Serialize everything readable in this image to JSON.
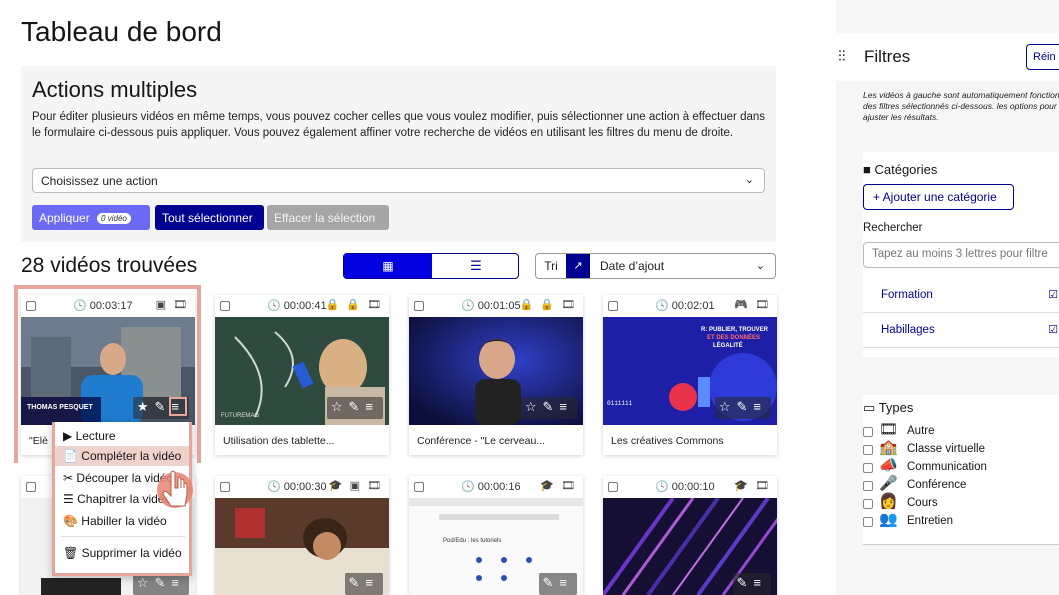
{
  "page_title": "Tableau de bord",
  "bulk": {
    "title": "Actions multiples",
    "description": "Pour éditer plusieurs vidéos en même temps, vous pouvez cocher celles que vous voulez modifier, puis sélectionner une action à effectuer dans le formulaire ci-dessous puis appliquer. Vous pouvez également affiner votre recherche de vidéos en utilisant les filtres du menu de droite.",
    "select_placeholder": "Choisissez une action",
    "apply_label": "Appliquer",
    "apply_badge": "0 vidéo",
    "select_all_label": "Tout sélectionner",
    "clear_label": "Effacer la sélection"
  },
  "results": {
    "count_label": "28 vidéos trouvées",
    "sort_label": "Tri",
    "sort_direction_icon": "↗",
    "sort_value": "Date d’ajout"
  },
  "videos": [
    {
      "duration": "00:03:17",
      "title": "\"Elè",
      "icons": "▣ 🎞"
    },
    {
      "duration": "00:00:41",
      "title": "Utilisation des tablette...",
      "icons": "🔒 🔒 🎞"
    },
    {
      "duration": "00:01:05",
      "title": "Conférence - \"Le cerveau...",
      "icons": "🔒 🔒 🎞"
    },
    {
      "duration": "00:02:01",
      "title": "Les créatives Commons",
      "icons": "🎮 🎞"
    },
    {
      "duration": "",
      "title": "",
      "icons": ""
    },
    {
      "duration": "00:00:30",
      "title": "",
      "icons": "🎓 ▣ 🎞"
    },
    {
      "duration": "00:00:16",
      "title": "",
      "icons": "🎓 🎞"
    },
    {
      "duration": "00:00:10",
      "title": "",
      "icons": "🎓 🎞"
    }
  ],
  "thumb_texts": {
    "v1_name": "THOMAS PESQUET",
    "v2_caption": "FUTUREMAG",
    "v4_text1": "R: PUBLIER, TROUVER",
    "v4_text2": "ET DES DONNÉES",
    "v4_text3": "LÉGALITÉ",
    "v7_title": "Pod/Edu : les tutoriels"
  },
  "context_menu": {
    "items": [
      "Lecture",
      "Compléter la vidéo",
      "Découper la vidéo",
      "Chapitrer la vidéo",
      "Habiller la vidéo",
      "Supprimer la vidéo"
    ],
    "icons": [
      "▶",
      "📄",
      "✂",
      "☰",
      "🎨",
      "🗑"
    ],
    "active_index": 1
  },
  "sidebar": {
    "filters_title": "Filtres",
    "reset_label": "Réin",
    "info": "Les vidéos à gauche sont automatiquement fonction des filtres sélectionnés ci-dessous. les options pour ajuster les résultats.",
    "categories_title": "Catégories",
    "add_category_label": "+ Ajouter une catégorie",
    "search_label": "Rechercher",
    "search_placeholder": "Tapez au moins 3 lettres pour filtre",
    "categories": [
      "Formation",
      "Habillages"
    ],
    "types_title": "Types",
    "types": [
      "Autre",
      "Classe virtuelle",
      "Communication",
      "Conférence",
      "Cours",
      "Entretien"
    ]
  },
  "colors": {
    "primary": "#000091",
    "accent": "#6a6af4",
    "highlight": "#e6a69b"
  }
}
